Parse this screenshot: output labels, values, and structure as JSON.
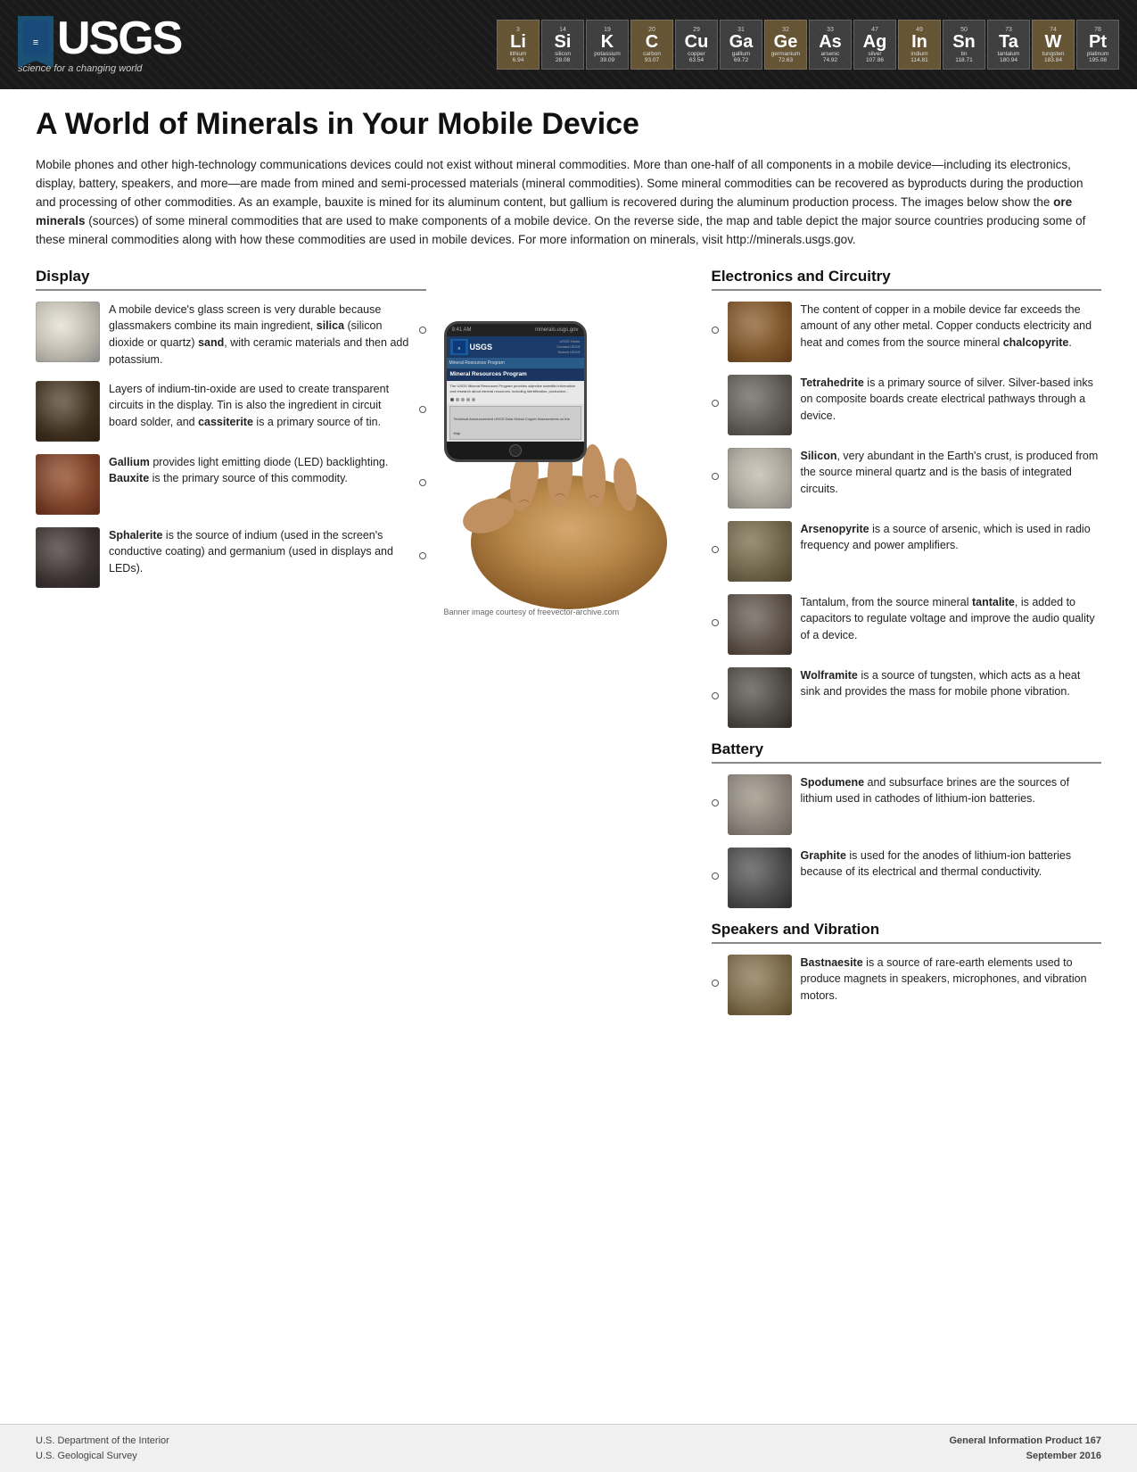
{
  "header": {
    "usgs_text": "USGS",
    "tagline": "science for a changing world",
    "elements": [
      {
        "number": "3",
        "symbol": "Li",
        "name": "lithium",
        "weight": "6.94"
      },
      {
        "number": "14",
        "symbol": "Si",
        "name": "silicon",
        "weight": "28.08"
      },
      {
        "number": "19",
        "symbol": "K",
        "name": "potassium",
        "weight": "39.09"
      },
      {
        "number": "20",
        "symbol": "C",
        "name": "carbon",
        "weight": "93.07"
      },
      {
        "number": "29",
        "symbol": "Cu",
        "name": "copper",
        "weight": "63.54"
      },
      {
        "number": "31",
        "symbol": "Ga",
        "name": "gallium",
        "weight": "69.72"
      },
      {
        "number": "32",
        "symbol": "Ge",
        "name": "germanium",
        "weight": "72.63"
      },
      {
        "number": "33",
        "symbol": "As",
        "name": "arsenic",
        "weight": "74.92"
      },
      {
        "number": "47",
        "symbol": "Ag",
        "name": "silver",
        "weight": "107.86"
      },
      {
        "number": "49",
        "symbol": "In",
        "name": "indium",
        "weight": "114.81"
      },
      {
        "number": "50",
        "symbol": "Sn",
        "name": "tin",
        "weight": "118.71"
      },
      {
        "number": "73",
        "symbol": "Ta",
        "name": "tantalum",
        "weight": "180.94"
      },
      {
        "number": "74",
        "symbol": "W",
        "name": "tungsten",
        "weight": "183.84"
      },
      {
        "number": "78",
        "symbol": "Pt",
        "name": "platinum",
        "weight": "195.08"
      }
    ]
  },
  "page": {
    "title": "A World of Minerals in Your Mobile Device",
    "intro": "Mobile phones and other high-technology communications devices could not exist without mineral commodities. More than one-half of all components in a mobile device—including its electronics, display, battery, speakers, and more—are made from mined and semi-processed materials (mineral commodities). Some mineral commodities can be recovered as byproducts during the production and processing of other commodities. As an example, bauxite is mined for its aluminum content, but gallium is recovered during the aluminum production process. The images below show the ore minerals (sources) of some mineral commodities that are used to make components of a mobile device. On the reverse side, the map and table depict the major source countries producing some of these mineral commodities along with how these commodities are used in mobile devices. For more information on minerals, visit",
    "intro_link": "http://minerals.usgs.gov.",
    "intro_bold_words": [
      "ore minerals"
    ]
  },
  "display_section": {
    "heading": "Display",
    "items": [
      {
        "id": "silica",
        "text": "A mobile device's glass screen is very durable because glassmakers combine its main ingredient, silica (silicon dioxide or quartz) sand, with ceramic materials and then add potassium.",
        "image_type": "quartz"
      },
      {
        "id": "cassiterite",
        "text": "Layers of indium-tin-oxide are used to create transparent circuits in the display. Tin is also the ingredient in circuit board solder, and cassiterite is a primary source of tin.",
        "image_type": "indium"
      },
      {
        "id": "bauxite",
        "text": "Gallium provides light emitting diode (LED) backlighting. Bauxite is the primary source of this commodity.",
        "image_type": "bauxite"
      },
      {
        "id": "sphalerite",
        "text": "Sphalerite is the source of indium (used in the screen's conductive coating) and germanium (used in displays and LEDs).",
        "image_type": "sphalerite"
      }
    ]
  },
  "electronics_section": {
    "heading": "Electronics and Circuitry",
    "items": [
      {
        "id": "chalcopyrite",
        "text": "The content of copper in a mobile device far exceeds the amount of any other metal. Copper conducts electricity and heat and comes from the source mineral chalcopyrite.",
        "image_type": "copper"
      },
      {
        "id": "tetrahedrite",
        "text": "Tetrahedrite is a primary source of silver. Silver-based inks on composite boards create electrical pathways through a device.",
        "image_type": "tetrahedrite"
      },
      {
        "id": "silicon",
        "text": "Silicon, very abundant in the Earth's crust, is produced from the source mineral quartz and is the basis of integrated circuits.",
        "image_type": "silicon"
      },
      {
        "id": "arsenopyrite",
        "text": "Arsenopyrite is a source of arsenic, which is used in radio frequency and power amplifiers.",
        "image_type": "arsenopyrite"
      },
      {
        "id": "tantalite",
        "text": "Tantalum, from the source mineral tantalite, is added to capacitors to regulate voltage and improve the audio quality of a device.",
        "image_type": "tantalite"
      },
      {
        "id": "wolframite",
        "text": "Wolframite is a source of tungsten, which acts as a heat sink and provides the mass for mobile phone vibration.",
        "image_type": "wolframite"
      }
    ]
  },
  "battery_section": {
    "heading": "Battery",
    "items": [
      {
        "id": "spodumene",
        "text": "Spodumene and subsurface brines are the sources of lithium used in cathodes of lithium-ion batteries.",
        "image_type": "spodumene"
      },
      {
        "id": "graphite",
        "text": "Graphite is used for the anodes of lithium-ion batteries because of its electrical and thermal conductivity.",
        "image_type": "graphite"
      }
    ]
  },
  "speakers_section": {
    "heading": "Speakers and Vibration",
    "items": [
      {
        "id": "bastnaesite",
        "text": "Bastnaesite is a source of rare-earth elements used to produce magnets in speakers, microphones, and vibration motors.",
        "image_type": "bastnaesite"
      }
    ]
  },
  "phone": {
    "url": "minerals.usgs.gov",
    "header_text": "USGS",
    "nav_items": [
      "USGS Home",
      "Contact USGS",
      "Search USGS"
    ],
    "section_title": "Mineral Resources Program",
    "banner_title": "Mineral Resources Program",
    "body_text": "The USGS Mineral Resources Program provides objective scientific information and research about mineral resources, including identification, production, and distribution...",
    "footer_text": "Technical Announcement USGS Data Global Copper Assessments on the Map"
  },
  "banner_credit": "Banner image courtesy of freevector-archive.com",
  "footer": {
    "left_line1": "U.S. Department of the Interior",
    "left_line2": "U.S. Geological Survey",
    "right_line1": "General Information Product 167",
    "right_line2": "September 2016"
  }
}
